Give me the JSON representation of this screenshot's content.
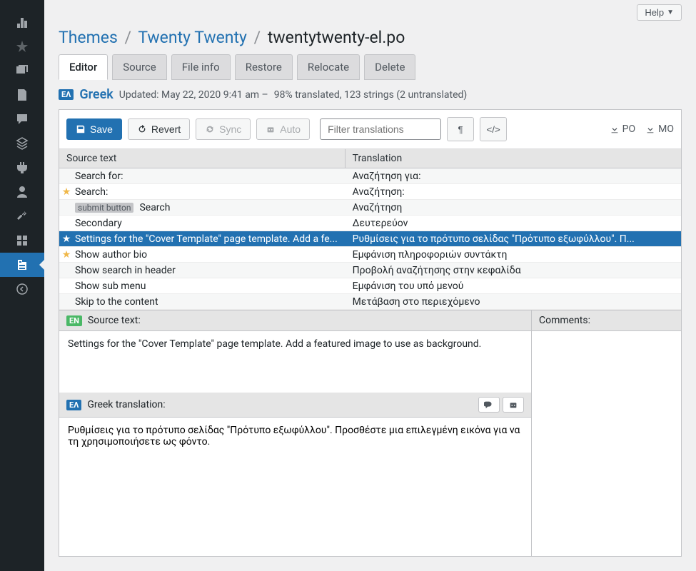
{
  "topbar": {
    "help": "Help"
  },
  "breadcrumb": {
    "themes": "Themes",
    "theme": "Twenty Twenty",
    "file": "twentytwenty-el.po"
  },
  "tabs": [
    {
      "id": "editor",
      "label": "Editor",
      "active": true
    },
    {
      "id": "source",
      "label": "Source"
    },
    {
      "id": "fileinfo",
      "label": "File info"
    },
    {
      "id": "restore",
      "label": "Restore"
    },
    {
      "id": "relocate",
      "label": "Relocate"
    },
    {
      "id": "delete",
      "label": "Delete"
    }
  ],
  "meta": {
    "lang_badge": "ΕΛ",
    "lang_name": "Greek",
    "updated": "Updated: May 22, 2020 9:41 am –",
    "stats": "98% translated, 123 strings (2 untranslated)"
  },
  "toolbar": {
    "save": "Save",
    "revert": "Revert",
    "sync": "Sync",
    "auto": "Auto",
    "filter_placeholder": "Filter translations",
    "po": "PO",
    "mo": "MO"
  },
  "table": {
    "head_src": "Source text",
    "head_tr": "Translation"
  },
  "rows": [
    {
      "star": "",
      "ctx": "",
      "src": "Search for:",
      "tr": "Αναζήτηση για:"
    },
    {
      "star": "★",
      "ctx": "",
      "src": "Search:",
      "tr": "Αναζήτηση:"
    },
    {
      "star": "",
      "ctx": "submit button",
      "src": "Search",
      "tr": "Αναζήτηση"
    },
    {
      "star": "",
      "ctx": "",
      "src": "Secondary",
      "tr": "Δευτερεύον"
    },
    {
      "star": "★",
      "ctx": "",
      "src": "Settings for the \"Cover Template\" page template. Add a fe...",
      "tr": "Ρυθμίσεις για το πρότυπο σελίδας \"Πρότυπο εξωφύλλου\". Π...",
      "selected": true
    },
    {
      "star": "★",
      "ctx": "",
      "src": "Show author bio",
      "tr": "Εμφάνιση πληροφοριών συντάκτη"
    },
    {
      "star": "",
      "ctx": "",
      "src": "Show search in header",
      "tr": "Προβολή αναζήτησης στην κεφαλίδα"
    },
    {
      "star": "",
      "ctx": "",
      "src": "Show sub menu",
      "tr": "Εμφάνιση του υπό μενού"
    },
    {
      "star": "",
      "ctx": "",
      "src": "Skip to the content",
      "tr": "Μετάβαση στο περιεχόμενο"
    }
  ],
  "editor": {
    "src_badge": "EN",
    "src_label": "Source text:",
    "src_value": "Settings for the \"Cover Template\" page template. Add a featured image to use as background.",
    "tr_badge": "ΕΛ",
    "tr_label": "Greek translation:",
    "tr_value": "Ρυθμίσεις για το πρότυπο σελίδας \"Πρότυπο εξωφύλλου\". Προσθέστε μια επιλεγμένη εικόνα για να τη χρησιμοποιήσετε ως φόντο.",
    "comments_label": "Comments:"
  }
}
